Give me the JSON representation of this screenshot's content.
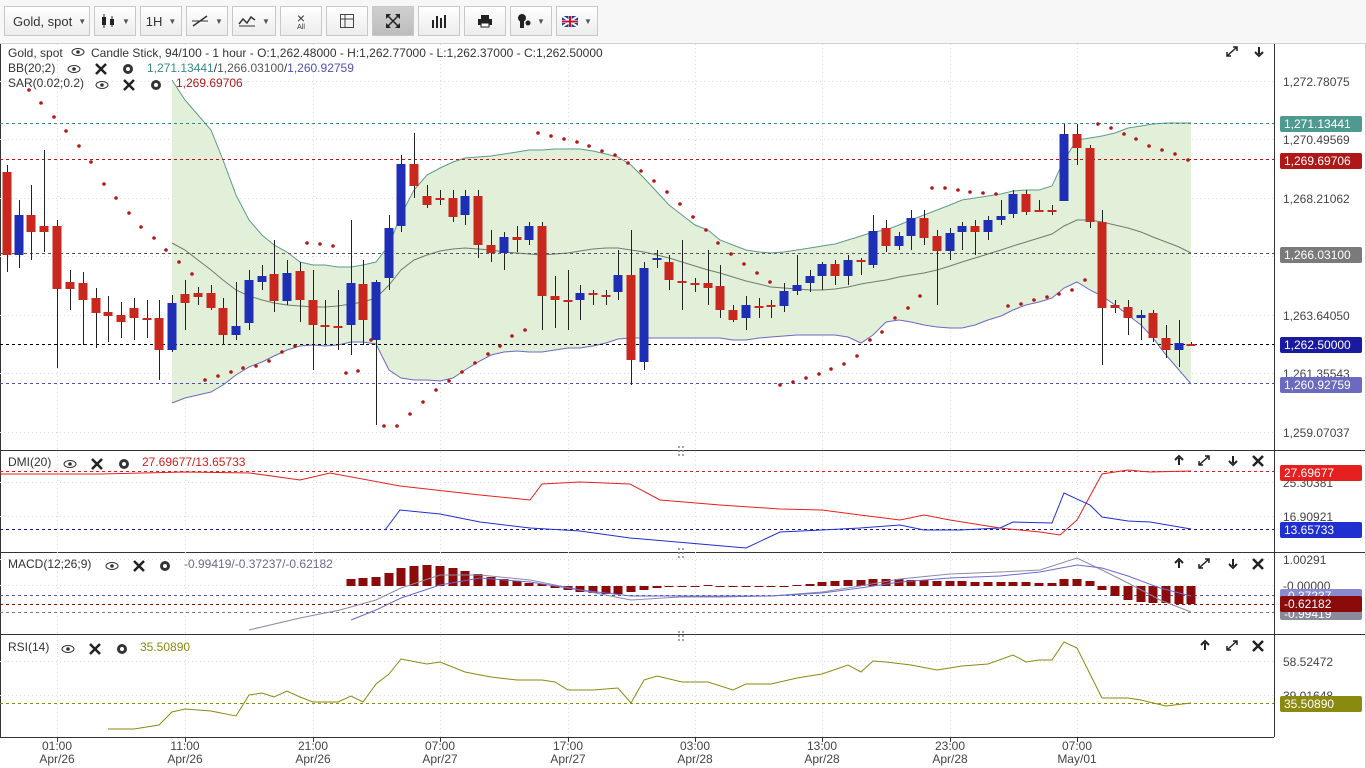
{
  "toolbar": {
    "symbol": "Gold, spot",
    "timeframe": "1H",
    "chart_type_icon": "candlestick-icon",
    "drawing_icon": "line-tool-icon",
    "studies_icon": "indicator-icon",
    "clear_label": "All",
    "grid_icon": "crosshair-grid-icon",
    "fullscreen_icon": "expand-icon",
    "volume_icon": "bars-icon",
    "print_icon": "printer-icon",
    "theme_icon": "paint-icon",
    "language_icon": "uk-flag-icon"
  },
  "main": {
    "title_symbol": "Gold, spot",
    "title_info": "Candle Stick, 94/100 - 1 hour - O:1,262.48000 - H:1,262.77000 - L:1,262.37000 - C:1,262.50000",
    "bb_name": "BB(20;2)",
    "bb_upper": "1,271.13441",
    "bb_mid": "1,266.03100",
    "bb_lower": "1,260.92759",
    "sar_name": "SAR(0.02;0.2)",
    "sar_value": "1,269.69706",
    "axis_ticks": [
      "1,272.78075",
      "1,270.49569",
      "1,268.21062",
      "1,263.64050",
      "1,261.35543",
      "1,259.07037"
    ],
    "tag_bb_upper": "1,271.13441",
    "tag_sar": "1,269.69706",
    "tag_bb_mid": "1,266.03100",
    "tag_close": "1,262.50000",
    "tag_bb_lower": "1,260.92759"
  },
  "dmi": {
    "name": "DMI(20)",
    "values": "27.69677/13.65733",
    "axis_ticks": [
      "25.30381",
      "16.90921"
    ],
    "tag_plus": "27.69677",
    "tag_minus": "13.65733"
  },
  "macd": {
    "name": "MACD(12;26;9)",
    "values": "-0.99419/-0.37237/-0.62182",
    "axis_ticks": [
      "1.00291",
      "-0.00000",
      "-0.37237",
      "-0.99419"
    ],
    "tag_hist": "-0.62182"
  },
  "rsi": {
    "name": "RSI(14)",
    "value": "35.50890",
    "axis_ticks": [
      "58.52472",
      "39.01648"
    ],
    "tag": "35.50890"
  },
  "time_axis": [
    {
      "t": "01:00",
      "d": "Apr/26"
    },
    {
      "t": "11:00",
      "d": "Apr/26"
    },
    {
      "t": "21:00",
      "d": "Apr/26"
    },
    {
      "t": "07:00",
      "d": "Apr/27"
    },
    {
      "t": "17:00",
      "d": "Apr/27"
    },
    {
      "t": "03:00",
      "d": "Apr/28"
    },
    {
      "t": "13:00",
      "d": "Apr/28"
    },
    {
      "t": "23:00",
      "d": "Apr/28"
    },
    {
      "t": "07:00",
      "d": "May/01"
    }
  ],
  "colors": {
    "bull": "#1f2fb5",
    "bear": "#c8281e",
    "sar": "#b01818",
    "bb_fill": "#e2f0da",
    "bb_line": "#5f9a8a",
    "dmi_plus": "#e62020",
    "dmi_minus": "#1f2fd0",
    "macd_hist": "#8b0a0a",
    "rsi": "#8a8a10"
  }
}
